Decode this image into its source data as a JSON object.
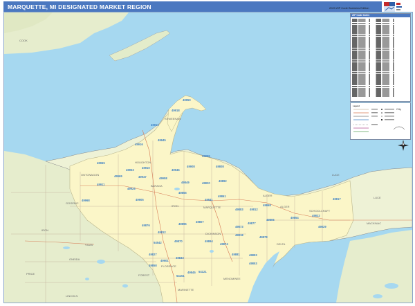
{
  "header": {
    "title": "MARQUETTE, MI DESIGNATED MARKET REGION",
    "edition": "2023 ZIP Code Business Edition"
  },
  "brand": {
    "logo_icon": "market-maps-logo-icon",
    "colors": {
      "title_bar": "#4b78c0",
      "water": "#9fd4ef",
      "land": "#e8eed0",
      "region": "#fbf6c8",
      "zip_label": "#3b7fc4"
    }
  },
  "map": {
    "zip_labels": [
      "49950",
      "49918",
      "49913",
      "49945",
      "49916",
      "49965",
      "49953",
      "49910",
      "49911",
      "49968",
      "49947",
      "49969",
      "49925",
      "49905",
      "49946",
      "49908",
      "49958",
      "49808",
      "49855",
      "49849",
      "49820",
      "49892",
      "49855",
      "49841",
      "49861",
      "49812",
      "49817",
      "49822",
      "49883",
      "49806",
      "49854",
      "49829",
      "49878",
      "49807",
      "49896",
      "49894",
      "49818",
      "49874",
      "49870",
      "49812",
      "49876",
      "49901",
      "49833",
      "49845",
      "49881",
      "49893",
      "49853",
      "49868",
      "49827",
      "54121",
      "54542",
      "49873",
      "49877",
      "54151",
      "49858"
    ],
    "counties": [
      "COOK",
      "BARAGA",
      "IRON",
      "DICKINSON",
      "MARQUETTE",
      "DELTA",
      "SCHOOLCRAFT",
      "LUCE",
      "MACKINAC",
      "FLORENCE",
      "FOREST",
      "MARINETTE",
      "MENOMINEE",
      "ALGER",
      "GOGEBIC",
      "ONTONAGON",
      "HOUGHTON",
      "KEWEENAW",
      "VILAS",
      "ONEIDA",
      "LINCOLN",
      "PRICE",
      "IRON",
      "ALGER",
      "LUCE"
    ]
  },
  "legend": {
    "list_title": "ZIP Code Index",
    "key_title": "Legend"
  }
}
